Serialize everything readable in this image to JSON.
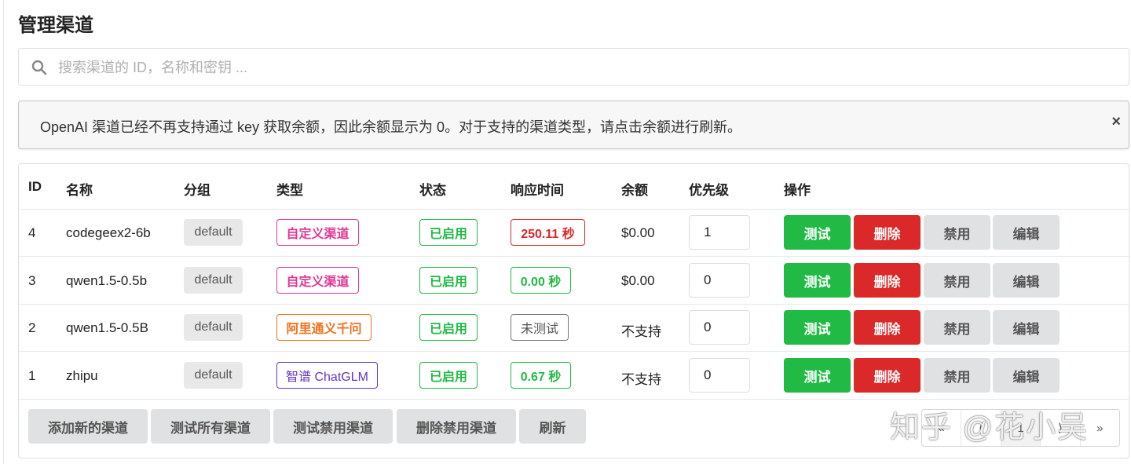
{
  "page": {
    "title": "管理渠道"
  },
  "search": {
    "placeholder": "搜索渠道的 ID，名称和密钥 ...",
    "value": ""
  },
  "notice": {
    "text": "OpenAI 渠道已经不再支持通过 key 获取余额，因此余额显示为 0。对于支持的渠道类型，请点击余额进行刷新。",
    "close_icon": "×"
  },
  "table": {
    "headers": [
      "ID",
      "名称",
      "分组",
      "类型",
      "状态",
      "响应时间",
      "余额",
      "优先级",
      "操作"
    ],
    "rows": [
      {
        "id": "4",
        "name": "codegeex2-6b",
        "group": "default",
        "type": "自定义渠道",
        "type_color": "#e03997",
        "status": "已启用",
        "response": "250.11 秒",
        "response_color": "#db2828",
        "balance": "$0.00",
        "priority": "1"
      },
      {
        "id": "3",
        "name": "qwen1.5-0.5b",
        "group": "default",
        "type": "自定义渠道",
        "type_color": "#e03997",
        "status": "已启用",
        "response": "0.00 秒",
        "response_color": "#21ba45",
        "balance": "$0.00",
        "priority": "0"
      },
      {
        "id": "2",
        "name": "qwen1.5-0.5B",
        "group": "default",
        "type": "阿里通义千问",
        "type_color": "#f2711c",
        "status": "已启用",
        "response": "未测试",
        "response_color": "#767676",
        "balance": "不支持",
        "priority": "0"
      },
      {
        "id": "1",
        "name": "zhipu",
        "group": "default",
        "type": "智谱 ChatGLM",
        "type_color": "#6435c9",
        "status": "已启用",
        "response": "0.67 秒",
        "response_color": "#21ba45",
        "balance": "不支持",
        "priority": "0"
      }
    ],
    "actions": {
      "test": "测试",
      "delete": "删除",
      "disable": "禁用",
      "edit": "编辑"
    }
  },
  "footer": {
    "buttons": [
      "添加新的渠道",
      "测试所有渠道",
      "测试禁用渠道",
      "删除禁用渠道",
      "刷新"
    ],
    "pagination": [
      "«",
      "⟨",
      "1",
      "⟩",
      "»"
    ],
    "current_page": "1"
  },
  "watermark": "知乎 @花小吴",
  "colors": {
    "green": "#21ba45",
    "red": "#db2828",
    "pink": "#e03997",
    "orange": "#f2711c",
    "violet": "#6435c9",
    "grey_button": "#e0e1e2"
  }
}
